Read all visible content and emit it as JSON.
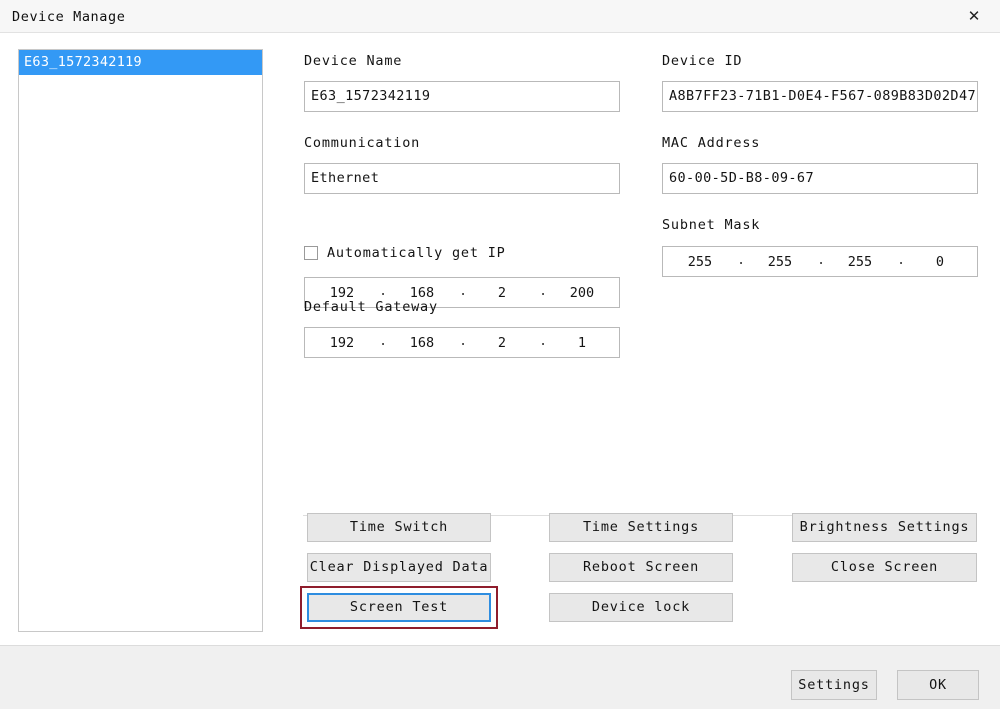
{
  "window": {
    "title": "Device Manage",
    "close_icon": "close-icon",
    "close_glyph": "✕"
  },
  "device_list": {
    "items": [
      {
        "label": "E63_1572342119",
        "selected": true
      }
    ],
    "selection_color": "#3399f5"
  },
  "form": {
    "device_name": {
      "label": "Device Name",
      "value": "E63_1572342119"
    },
    "device_id": {
      "label": "Device ID",
      "value": "A8B7FF23-71B1-D0E4-F567-089B83D02D47"
    },
    "communication": {
      "label": "Communication",
      "value": "Ethernet"
    },
    "mac_address": {
      "label": "MAC Address",
      "value": "60-00-5D-B8-09-67"
    },
    "auto_ip": {
      "label": "Automatically get IP",
      "checked": false
    },
    "ip_address": {
      "octets": [
        "192",
        "168",
        "2",
        "200"
      ],
      "separator": "."
    },
    "subnet_mask": {
      "label": "Subnet Mask",
      "octets": [
        "255",
        "255",
        "255",
        "0"
      ],
      "separator": "."
    },
    "default_gateway": {
      "label": "Default Gateway",
      "octets": [
        "192",
        "168",
        "2",
        "1"
      ],
      "separator": "."
    }
  },
  "actions": {
    "time_switch": "Time Switch",
    "time_settings": "Time Settings",
    "brightness_settings": "Brightness Settings",
    "clear_displayed_data": "Clear Displayed Data",
    "reboot_screen": "Reboot Screen",
    "close_screen": "Close Screen",
    "screen_test": "Screen Test",
    "device_lock": "Device lock",
    "focused_button": "Screen Test",
    "highlight_color": "#8f1d2c",
    "focus_color": "#2e8de0"
  },
  "footer": {
    "settings": "Settings",
    "ok": "OK"
  }
}
